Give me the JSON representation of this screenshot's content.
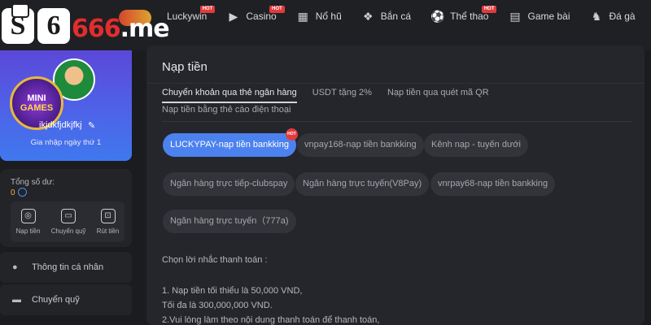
{
  "logo": {
    "text_main": "S6S",
    "text_accent": "666",
    "text_suffix": ".me"
  },
  "nav": [
    {
      "label": "Luckywin",
      "icon": "luckywin-icon",
      "glyph": "",
      "hot": true,
      "hot_label": "HOT"
    },
    {
      "label": "Casino",
      "icon": "play-icon",
      "glyph": "▶",
      "hot": true,
      "hot_label": "HOT"
    },
    {
      "label": "Nổ hũ",
      "icon": "slot-machine-icon",
      "glyph": "▦",
      "hot": false
    },
    {
      "label": "Bắn cá",
      "icon": "fish-icon",
      "glyph": "❖",
      "hot": false
    },
    {
      "label": "Thể thao",
      "icon": "soccer-ball-icon",
      "glyph": "⚽",
      "hot": true,
      "hot_label": "HOT"
    },
    {
      "label": "Game bài",
      "icon": "cards-icon",
      "glyph": "▤",
      "hot": false
    },
    {
      "label": "Đá gà",
      "icon": "rooster-icon",
      "glyph": "♞",
      "hot": false
    }
  ],
  "profile": {
    "badge_line1": "MINI",
    "badge_line2": "GAMES",
    "username": "ikjdkfjdkjfkj",
    "joined": "Gia nhập ngày thứ 1"
  },
  "balance": {
    "label": "Tổng số dư:",
    "value": "0",
    "actions": [
      {
        "label": "Nạp tiền",
        "icon": "deposit-icon",
        "glyph": "◎"
      },
      {
        "label": "Chuyển quỹ",
        "icon": "wallet-icon",
        "glyph": "▭"
      },
      {
        "label": "Rút tiền",
        "icon": "withdraw-icon",
        "glyph": "⊡"
      }
    ]
  },
  "side_menu": [
    {
      "label": "Thông tin cá nhân",
      "icon": "user-icon",
      "glyph": "●"
    },
    {
      "label": "Chuyển quỹ",
      "icon": "wallet-icon",
      "glyph": "▬"
    }
  ],
  "main": {
    "title": "Nạp tiền",
    "tabs": [
      {
        "label": "Chuyển khoản qua thẻ ngân hàng",
        "active": true
      },
      {
        "label": "USDT tặng 2%",
        "active": false
      },
      {
        "label": "Nạp tiền qua quét mã QR",
        "active": false
      }
    ],
    "tab_row2": "Nạp tiền bằng thẻ cào điện thoại",
    "methods": [
      {
        "label": "LUCKYPAY-nạp tiền bankking",
        "active": true,
        "hot": true,
        "hot_label": "HOT"
      },
      {
        "label": "vnpay168-nạp tiền bankking",
        "active": false
      },
      {
        "label": "Kênh nạp - tuyến dưới",
        "active": false
      },
      {
        "label": "Ngân hàng trực tiếp-clubspay",
        "active": false
      },
      {
        "label": "Ngân hàng trực tuyến(V8Pay)",
        "active": false
      },
      {
        "label": "vnrpay68-nạp tiền bankking",
        "active": false
      },
      {
        "label": "Ngân hàng trực tuyến（777a)",
        "active": false
      }
    ],
    "notes_title": "Chọn lời nhắc thanh toán :",
    "notes": [
      "1. Nạp tiền tối thiểu là 50,000 VND,",
      "Tối đa là 300,000,000 VND.",
      "2.Vui lòng làm theo nội dung thanh toán để thanh toán,"
    ]
  },
  "colors": {
    "accent": "#4c82ef",
    "hot": "#e23b3b",
    "background": "#1b1c20",
    "panel": "#25262b"
  }
}
